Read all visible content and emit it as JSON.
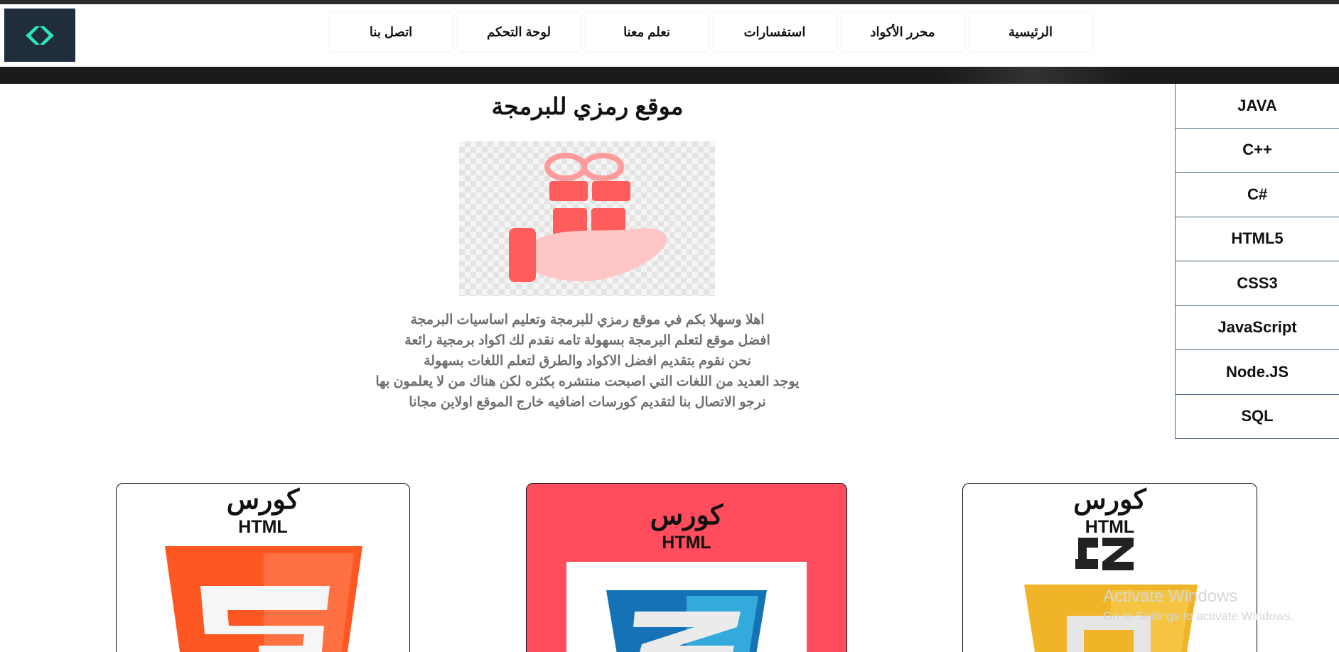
{
  "nav": {
    "items": [
      "الرئيسية",
      "محرر الأكواد",
      "استفسارات",
      "نعلم معنا",
      "لوحة التحكم",
      "اتصل بنا"
    ]
  },
  "main": {
    "title": "موقع رمزي للبرمجة",
    "intro_lines": [
      "اهلا وسهلا بكم في موقع رمزي للبرمجة وتعليم اساسيات البرمجة",
      "افضل موقع لتعلم البرمجة بسهولة تامه نقدم لك اكواد برمجية رائعة",
      "نحن نقوم بتقديم افضل الاكواد والطرق لتعلم اللغات بسهولة",
      "يوجد العديد من اللغات التي اصبحت منتشره بكثره لكن هناك من لا يعلمون بها",
      "نرجو الاتصال بنا لتقديم كورسات اضافيه خارج الموقع اولاين مجانا"
    ]
  },
  "sidebar": {
    "items": [
      "JAVA",
      "C++",
      "C#",
      "HTML5",
      "CSS3",
      "JavaScript",
      "Node.JS",
      "SQL"
    ]
  },
  "cards": [
    {
      "title": "كورس",
      "subtitle": "HTML",
      "icon": "html5-icon"
    },
    {
      "title": "كورس",
      "subtitle": "HTML",
      "icon": "css3-icon"
    },
    {
      "title": "كورس",
      "subtitle": "HTML",
      "icon": "js-icon"
    }
  ],
  "watermark": {
    "line1": "Activate Windows",
    "line2": "Go to Settings to activate Windows."
  },
  "colors": {
    "logo_bg": "#1f2d3d",
    "logo_accent": "#2ee5b4",
    "card_highlight": "#ff4d5e",
    "html5": "#ff5722",
    "css3": "#1572b6",
    "js": "#f0b429"
  }
}
